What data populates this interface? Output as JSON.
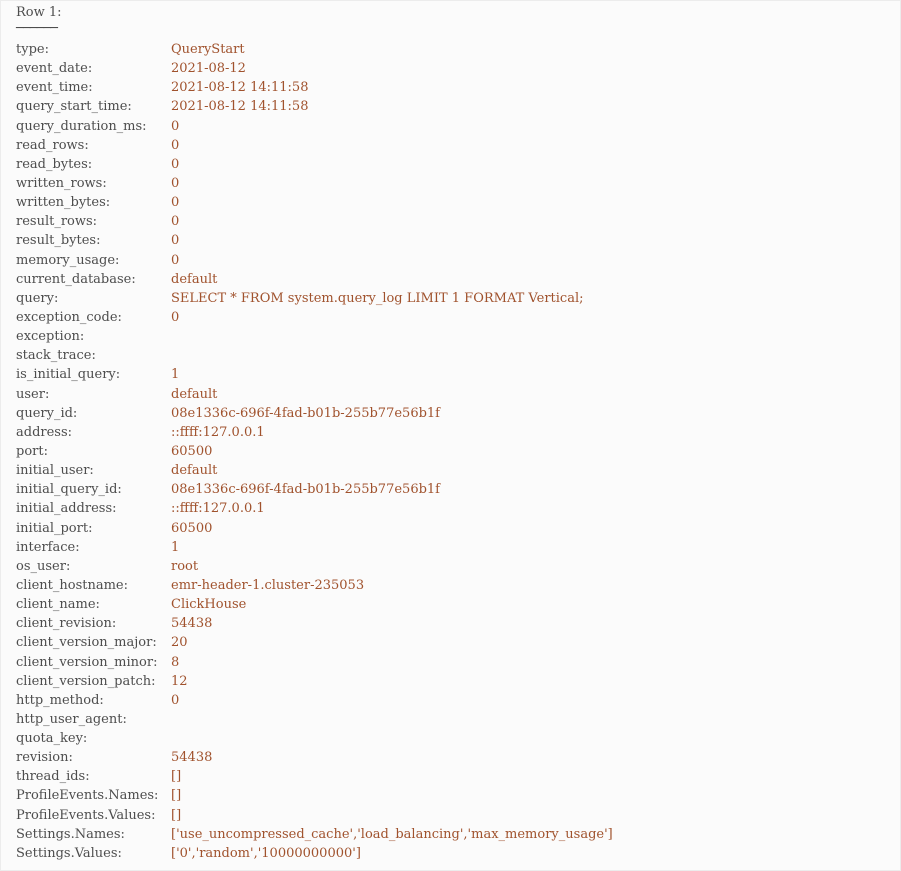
{
  "header": {
    "row_label": "Row 1:",
    "divider": "──────"
  },
  "fields": [
    {
      "key": "type:",
      "value": "QueryStart"
    },
    {
      "key": "event_date:",
      "value": "2021-08-12"
    },
    {
      "key": "event_time:",
      "value": "2021-08-12 14:11:58"
    },
    {
      "key": "query_start_time:",
      "value": "2021-08-12 14:11:58"
    },
    {
      "key": "query_duration_ms:",
      "value": "0"
    },
    {
      "key": "read_rows:",
      "value": "0"
    },
    {
      "key": "read_bytes:",
      "value": "0"
    },
    {
      "key": "written_rows:",
      "value": "0"
    },
    {
      "key": "written_bytes:",
      "value": "0"
    },
    {
      "key": "result_rows:",
      "value": "0"
    },
    {
      "key": "result_bytes:",
      "value": "0"
    },
    {
      "key": "memory_usage:",
      "value": "0"
    },
    {
      "key": "current_database:",
      "value": "default"
    },
    {
      "key": "query:",
      "value": "SELECT * FROM system.query_log LIMIT 1 FORMAT Vertical;"
    },
    {
      "key": "exception_code:",
      "value": "0"
    },
    {
      "key": "exception:",
      "value": ""
    },
    {
      "key": "stack_trace:",
      "value": ""
    },
    {
      "key": "is_initial_query:",
      "value": "1"
    },
    {
      "key": "user:",
      "value": "default"
    },
    {
      "key": "query_id:",
      "value": "08e1336c-696f-4fad-b01b-255b77e56b1f"
    },
    {
      "key": "address:",
      "value": "::ffff:127.0.0.1"
    },
    {
      "key": "port:",
      "value": "60500"
    },
    {
      "key": "initial_user:",
      "value": "default"
    },
    {
      "key": "initial_query_id:",
      "value": "08e1336c-696f-4fad-b01b-255b77e56b1f"
    },
    {
      "key": "initial_address:",
      "value": "::ffff:127.0.0.1"
    },
    {
      "key": "initial_port:",
      "value": "60500"
    },
    {
      "key": "interface:",
      "value": "1"
    },
    {
      "key": "os_user:",
      "value": "root"
    },
    {
      "key": "client_hostname:",
      "value": "emr-header-1.cluster-235053"
    },
    {
      "key": "client_name:",
      "value": "ClickHouse"
    },
    {
      "key": "client_revision:",
      "value": "54438"
    },
    {
      "key": "client_version_major:",
      "value": "20"
    },
    {
      "key": "client_version_minor:",
      "value": "8"
    },
    {
      "key": "client_version_patch:",
      "value": "12"
    },
    {
      "key": "http_method:",
      "value": "0"
    },
    {
      "key": "http_user_agent:",
      "value": ""
    },
    {
      "key": "quota_key:",
      "value": ""
    },
    {
      "key": "revision:",
      "value": "54438"
    },
    {
      "key": "thread_ids:",
      "value": "[]"
    },
    {
      "key": "ProfileEvents.Names:",
      "value": "[]"
    },
    {
      "key": "ProfileEvents.Values:",
      "value": "[]"
    },
    {
      "key": "Settings.Names:",
      "value": "['use_uncompressed_cache','load_balancing','max_memory_usage']"
    },
    {
      "key": "Settings.Values:",
      "value": "['0','random','10000000000']"
    }
  ]
}
